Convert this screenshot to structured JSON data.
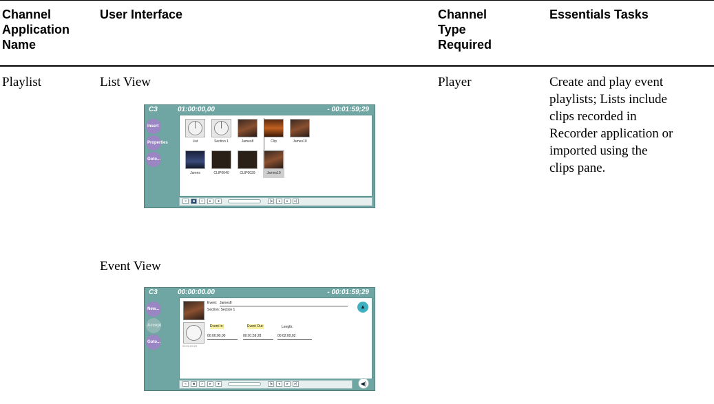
{
  "table": {
    "headers": [
      "Channel Application Name",
      "User Interface",
      "Channel Type Required",
      "Essentials Tasks"
    ],
    "header_lines": {
      "col1": [
        "Channel",
        "Application",
        "Name"
      ],
      "col2": [
        "User Interface"
      ],
      "col3": [
        "Channel",
        "Type",
        "Required"
      ],
      "col4": [
        "Essentials Tasks"
      ]
    },
    "row": {
      "app_name": "Playlist",
      "list_view_label": "List View",
      "event_view_label": "Event View",
      "channel_type": "Player",
      "tasks_lines": [
        "Create and play event",
        "playlists; Lists include",
        "clips recorded in",
        "Recorder application or",
        "imported using the",
        "clips pane."
      ]
    }
  },
  "list_view_screen": {
    "channel": "C3",
    "timecode": "01:00:00,00",
    "remaining": "- 00:01:59;29",
    "side_buttons": [
      "Insert",
      "Properties",
      "Goto..."
    ],
    "thumbnails": [
      "List",
      "Section 1",
      "James8",
      "Clip",
      "James10",
      "James",
      "CLIP0040",
      "CLIP0039",
      "James10"
    ]
  },
  "event_view_screen": {
    "channel": "C3",
    "timecode": "00:00:00.00",
    "remaining": "- 00:01:59;29",
    "side_buttons": [
      "New...",
      "Accept",
      "Goto..."
    ],
    "event_label": "Event:",
    "event_name": "James8",
    "section_text": "Section: Section 1",
    "event_in_label": "Event In:",
    "event_out_label": "Event Out:",
    "length_label": "Length:",
    "event_in_value": "00:00:00.00",
    "event_out_value": "00:01:59.28",
    "length_value": "00:02:00,02",
    "dial_time": "00:01:59;29"
  }
}
